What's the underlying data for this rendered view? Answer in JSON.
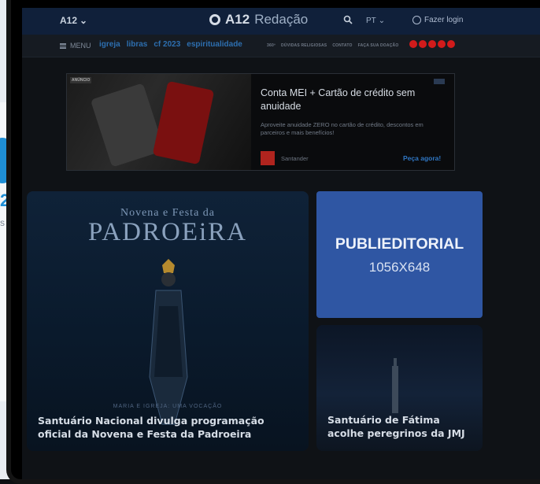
{
  "background_page": {
    "logo_fragment": "2",
    "text_fragment": "s"
  },
  "header": {
    "brand_menu": "A12",
    "logo_bold": "A12",
    "logo_light": "Redação",
    "language": "PT",
    "login": "Fazer login"
  },
  "subnav": {
    "menu_label": "MENU",
    "tags": [
      "igreja",
      "libras",
      "cf 2023",
      "espiritualidade"
    ],
    "links": [
      "360º",
      "DÚVIDAS RELIGIOSAS",
      "CONTATO",
      "FAÇA SUA DOAÇÃO"
    ],
    "social_colors": [
      "#d11b1b",
      "#d11b1b",
      "#d11b1b",
      "#d11b1b",
      "#d11b1b"
    ]
  },
  "ad": {
    "badge": "ANÚNCIO",
    "title": "Conta MEI + Cartão de crédito sem anuidade",
    "description": "Aproveite anuidade ZERO no cartão de crédito, descontos em parceiros e mais benefícios!",
    "brand": "Santander",
    "cta": "Peça agora!"
  },
  "cards": {
    "hero": {
      "kicker": "Novena e Festa da",
      "big": "PADROEiRA",
      "subline": "MARIA E IGREJA: UMA VOCAÇÃO",
      "title": "Santuário Nacional divulga programação oficial da Novena e Festa da Padroeira"
    },
    "publi": {
      "line1": "PUBLIEDITORIAL",
      "line2": "1056X648"
    },
    "second": {
      "title": "Santuário de Fátima acolhe peregrinos da JMJ"
    }
  },
  "colors": {
    "topbar": "#10203a",
    "accent_blue": "#2f56a3",
    "tag_blue": "#2d6fb0"
  }
}
